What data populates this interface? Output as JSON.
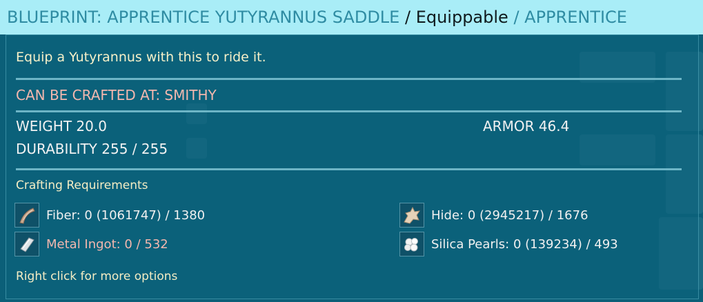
{
  "header": {
    "title": "BLUEPRINT: APPRENTICE YUTYRANNUS SADDLE",
    "sep1": " / ",
    "type": "Equippable",
    "sep2": " / ",
    "quality": "APPRENTICE"
  },
  "description": "Equip a Yutyrannus with this to ride it.",
  "crafted_at": "CAN BE CRAFTED AT: SMITHY",
  "stats": {
    "weight": "WEIGHT 20.0",
    "durability": "DURABILITY 255 / 255",
    "armor": "ARMOR 46.4"
  },
  "requirements": {
    "title": "Crafting Requirements",
    "items": [
      {
        "label": "Fiber: 0 (1061747) / 1380",
        "icon": "fiber-icon"
      },
      {
        "label": "Hide: 0 (2945217) / 1676",
        "icon": "hide-icon"
      },
      {
        "label": "Metal Ingot: 0 / 532",
        "icon": "metal-ingot-icon"
      },
      {
        "label": "Silica Pearls: 0 (139234) / 493",
        "icon": "silica-pearls-icon"
      }
    ]
  },
  "footer_hint": "Right click for more options",
  "colors": {
    "header_bg": "#a9edf7",
    "header_teal": "#2f8ca3",
    "panel_bg": "#0b5f78",
    "highlight_red": "#f3b7ae",
    "cream": "#f6f0c8"
  }
}
